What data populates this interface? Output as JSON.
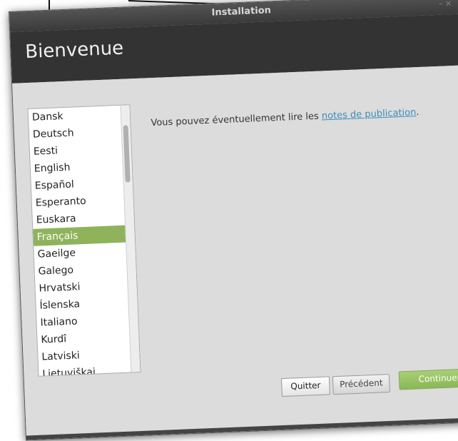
{
  "window": {
    "title": "Installation",
    "controls": "– ×"
  },
  "header": {
    "title": "Bienvenue"
  },
  "languages": {
    "items": [
      "Dansk",
      "Deutsch",
      "Eesti",
      "English",
      "Español",
      "Esperanto",
      "Euskara",
      "Français",
      "Gaeilge",
      "Galego",
      "Hrvatski",
      "Íslenska",
      "Italiano",
      "Kurdî",
      "Latviski",
      "Lietuviškai"
    ],
    "selected": "Français"
  },
  "release": {
    "text": "Vous pouvez éventuellement lire les ",
    "link": "notes de publication",
    "suffix": "."
  },
  "buttons": {
    "quit": "Quitter",
    "previous": "Précédent",
    "continue": "Continuer"
  },
  "colors": {
    "accent": "#8fb35b",
    "header_bg": "#333333",
    "link": "#3c8dbb"
  }
}
